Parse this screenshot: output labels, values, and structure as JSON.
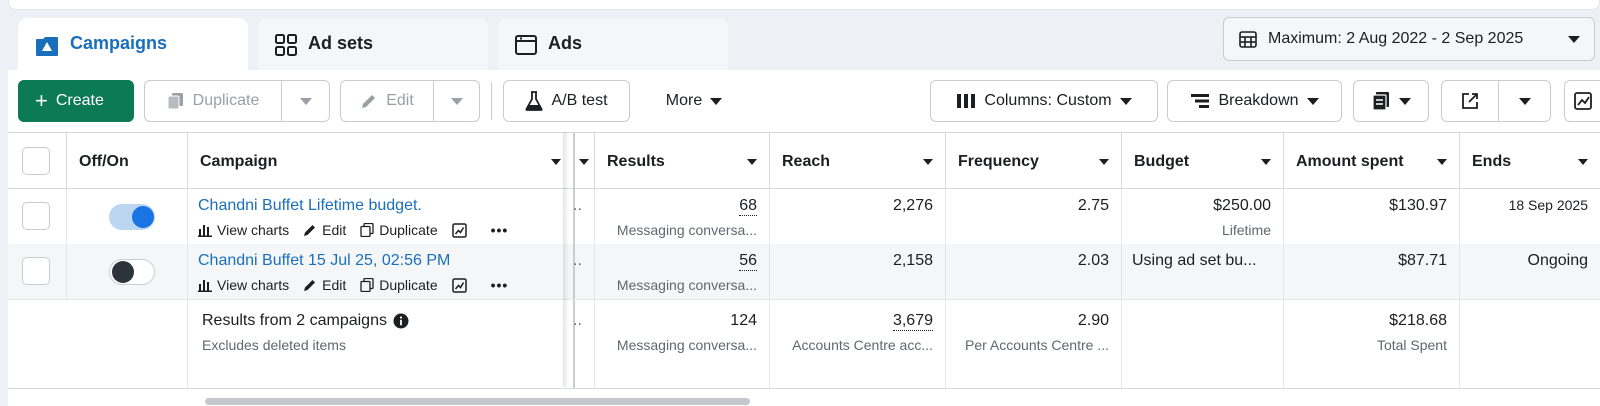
{
  "tabs": [
    {
      "label": "Campaigns",
      "icon": "campaigns-icon"
    },
    {
      "label": "Ad sets",
      "icon": "grid-icon"
    },
    {
      "label": "Ads",
      "icon": "ad-icon"
    }
  ],
  "date_range": {
    "label": "Maximum: 2 Aug 2022 - 2 Sep 2025",
    "icon": "calendar-icon"
  },
  "toolbar": {
    "create": "Create",
    "duplicate": "Duplicate",
    "edit": "Edit",
    "ab_test": "A/B test",
    "more": "More",
    "columns": "Columns: Custom",
    "breakdown": "Breakdown"
  },
  "columns": {
    "off_on": "Off/On",
    "campaign": "Campaign",
    "results": "Results",
    "reach": "Reach",
    "frequency": "Frequency",
    "budget": "Budget",
    "amount_spent": "Amount spent",
    "ends": "Ends"
  },
  "row_actions": {
    "view_charts": "View charts",
    "edit": "Edit",
    "duplicate": "Duplicate"
  },
  "rows": [
    {
      "name": "Chandni Buffet Lifetime budget.",
      "on": true,
      "results": "68",
      "results_sub": "Messaging conversa...",
      "reach": "2,276",
      "frequency": "2.75",
      "budget": "$250.00",
      "budget_sub": "Lifetime",
      "amount_spent": "$130.97",
      "ends": "18 Sep 2025"
    },
    {
      "name": "Chandni Buffet 15 Jul 25, 02:56 PM",
      "on": false,
      "results": "56",
      "results_sub": "Messaging conversa...",
      "reach": "2,158",
      "frequency": "2.03",
      "budget": "Using ad set bu...",
      "amount_spent": "$87.71",
      "ends": "Ongoing"
    }
  ],
  "summary": {
    "title": "Results from 2 campaigns",
    "subtitle": "Excludes deleted items",
    "results": "124",
    "results_sub": "Messaging conversa...",
    "reach": "3,679",
    "reach_sub": "Accounts Centre acc...",
    "frequency": "2.90",
    "frequency_sub": "Per Accounts Centre ...",
    "amount_spent": "$218.68",
    "amount_spent_sub": "Total Spent"
  },
  "colors": {
    "accent": "#1a6fba",
    "create_green": "#0b7a55",
    "toggle_on": "#1b74e4"
  }
}
